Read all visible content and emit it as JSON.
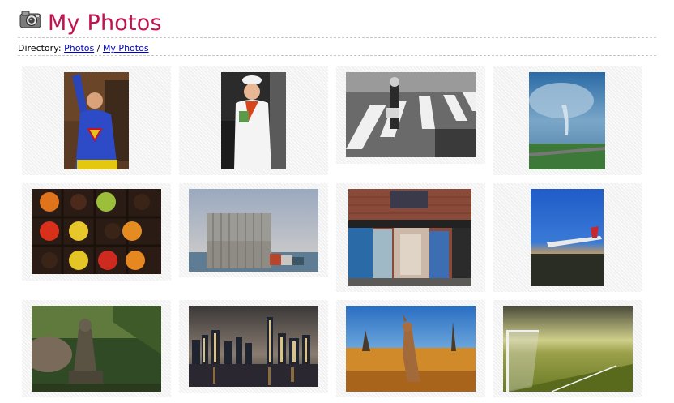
{
  "page": {
    "title": "My Photos",
    "icon": "camera-icon"
  },
  "breadcrumb": {
    "label": "Directory:",
    "separator": "/",
    "links": [
      "Photos",
      "My Photos"
    ]
  },
  "gallery": {
    "photos": [
      {
        "subject": "superman-costume-man"
      },
      {
        "subject": "woman-in-white-outfit"
      },
      {
        "subject": "street-crosswalk"
      },
      {
        "subject": "tornado-over-field"
      },
      {
        "subject": "fruit-in-box"
      },
      {
        "subject": "shipping-containers"
      },
      {
        "subject": "brick-storefront"
      },
      {
        "subject": "airplane-at-dusk"
      },
      {
        "subject": "stone-buddha-statue"
      },
      {
        "subject": "city-skyline-night"
      },
      {
        "subject": "kangaroo-in-field"
      },
      {
        "subject": "soccer-field-goal"
      }
    ]
  }
}
